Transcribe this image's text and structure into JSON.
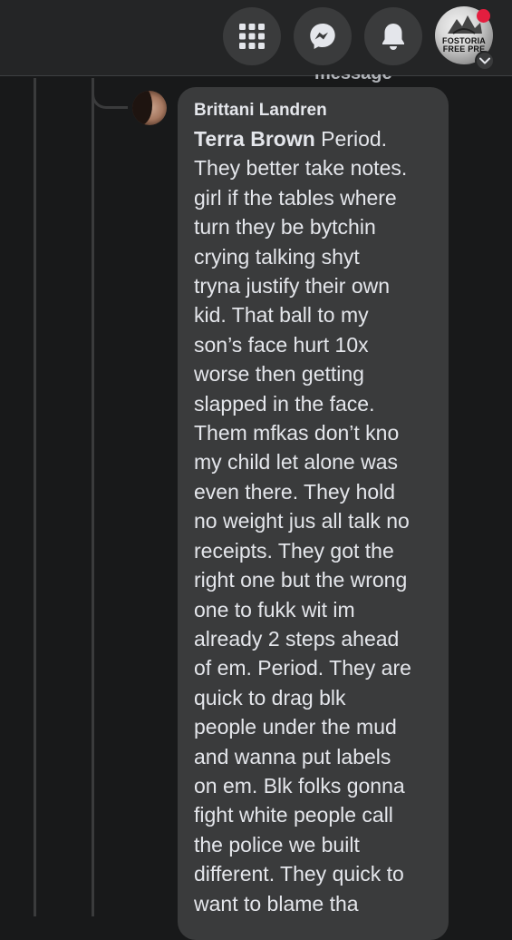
{
  "topbar": {
    "buttons": [
      {
        "name": "menu-grid-icon"
      },
      {
        "name": "messenger-icon"
      },
      {
        "name": "notifications-bell-icon"
      }
    ],
    "profile": {
      "text_line1": "FOSTORIA",
      "text_line2": "FREE PRE",
      "icon": "chevron-down-icon",
      "badge_color": "#e41e3f"
    }
  },
  "peek": {
    "text": "message"
  },
  "comment": {
    "author": "Brittani Landren",
    "mention": "Terra Brown",
    "lines": [
      " Period.",
      "They better take notes.",
      "girl if the tables where",
      "turn they be bytchin",
      "crying talking shyt",
      "tryna justify their own",
      "kid. That ball to my",
      "son’s face hurt 10x",
      "worse then getting",
      "slapped in the face.",
      "Them mfkas don’t kno",
      "my child let alone was",
      "even there. They hold",
      "no weight jus all talk no",
      "receipts. They got the",
      "right one but the wrong",
      "one to fukk wit im",
      "already 2 steps ahead",
      "of em. Period. They are",
      "quick to drag blk",
      "people under the mud",
      "and wanna put labels",
      "on em. Blk folks gonna",
      "fight white people call",
      "the police we built",
      "different. They quick to",
      "want to blame tha"
    ]
  },
  "colors": {
    "background": "#18191a",
    "topbar": "#242526",
    "bubble": "#3a3b3c",
    "text": "#e4e6eb"
  }
}
